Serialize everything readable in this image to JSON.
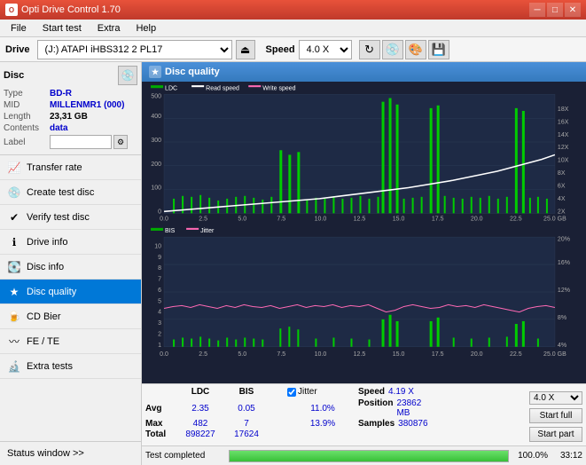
{
  "app": {
    "title": "Opti Drive Control 1.70",
    "icon": "O"
  },
  "titlebar": {
    "minimize": "─",
    "maximize": "□",
    "close": "✕"
  },
  "menu": {
    "items": [
      "File",
      "Start test",
      "Extra",
      "Help"
    ]
  },
  "drivebar": {
    "label": "Drive",
    "drive_value": "(J:) ATAPI iHBS312  2 PL17",
    "speed_label": "Speed",
    "speed_value": "4.0 X"
  },
  "disc": {
    "title": "Disc",
    "type_label": "Type",
    "type_value": "BD-R",
    "mid_label": "MID",
    "mid_value": "MILLENMR1 (000)",
    "length_label": "Length",
    "length_value": "23,31 GB",
    "contents_label": "Contents",
    "contents_value": "data",
    "label_label": "Label",
    "label_value": ""
  },
  "nav": {
    "items": [
      {
        "id": "transfer-rate",
        "label": "Transfer rate",
        "icon": "📈",
        "active": false
      },
      {
        "id": "create-test-disc",
        "label": "Create test disc",
        "icon": "💿",
        "active": false
      },
      {
        "id": "verify-test-disc",
        "label": "Verify test disc",
        "icon": "✔",
        "active": false
      },
      {
        "id": "drive-info",
        "label": "Drive info",
        "icon": "ℹ",
        "active": false
      },
      {
        "id": "disc-info",
        "label": "Disc info",
        "icon": "💽",
        "active": false
      },
      {
        "id": "disc-quality",
        "label": "Disc quality",
        "icon": "★",
        "active": true
      },
      {
        "id": "cd-bier",
        "label": "CD Bier",
        "icon": "🍺",
        "active": false
      },
      {
        "id": "fe-te",
        "label": "FE / TE",
        "icon": "〰",
        "active": false
      },
      {
        "id": "extra-tests",
        "label": "Extra tests",
        "icon": "🔬",
        "active": false
      }
    ],
    "status_window": "Status window >>"
  },
  "chart": {
    "title": "Disc quality",
    "legend": {
      "ldc": "LDC",
      "read_speed": "Read speed",
      "write_speed": "Write speed"
    },
    "legend2": {
      "bis": "BIS",
      "jitter": "Jitter"
    },
    "top_y_left": [
      "500",
      "400",
      "300",
      "200",
      "100",
      "0"
    ],
    "top_y_right": [
      "18X",
      "16X",
      "14X",
      "12X",
      "10X",
      "8X",
      "6X",
      "4X",
      "2X"
    ],
    "bottom_y_left": [
      "10",
      "9",
      "8",
      "7",
      "6",
      "5",
      "4",
      "3",
      "2",
      "1"
    ],
    "bottom_y_right": [
      "20%",
      "16%",
      "12%",
      "8%",
      "4%"
    ],
    "x_axis": [
      "0.0",
      "2.5",
      "5.0",
      "7.5",
      "10.0",
      "12.5",
      "15.0",
      "17.5",
      "20.0",
      "22.5",
      "25.0 GB"
    ]
  },
  "stats": {
    "headers": [
      "",
      "LDC",
      "BIS",
      "",
      "Jitter",
      "Speed"
    ],
    "avg_label": "Avg",
    "avg_ldc": "2.35",
    "avg_bis": "0.05",
    "avg_jitter": "11.0%",
    "avg_speed": "4.19 X",
    "max_label": "Max",
    "max_ldc": "482",
    "max_bis": "7",
    "max_jitter": "13.9%",
    "position_label": "Position",
    "position_value": "23862 MB",
    "total_label": "Total",
    "total_ldc": "898227",
    "total_bis": "17624",
    "samples_label": "Samples",
    "samples_value": "380876",
    "speed_select": "4.0 X",
    "start_full": "Start full",
    "start_part": "Start part",
    "jitter_checked": true,
    "jitter_label": "Jitter"
  },
  "progress": {
    "status": "Test completed",
    "percent": "100.0%",
    "time": "33:12"
  }
}
